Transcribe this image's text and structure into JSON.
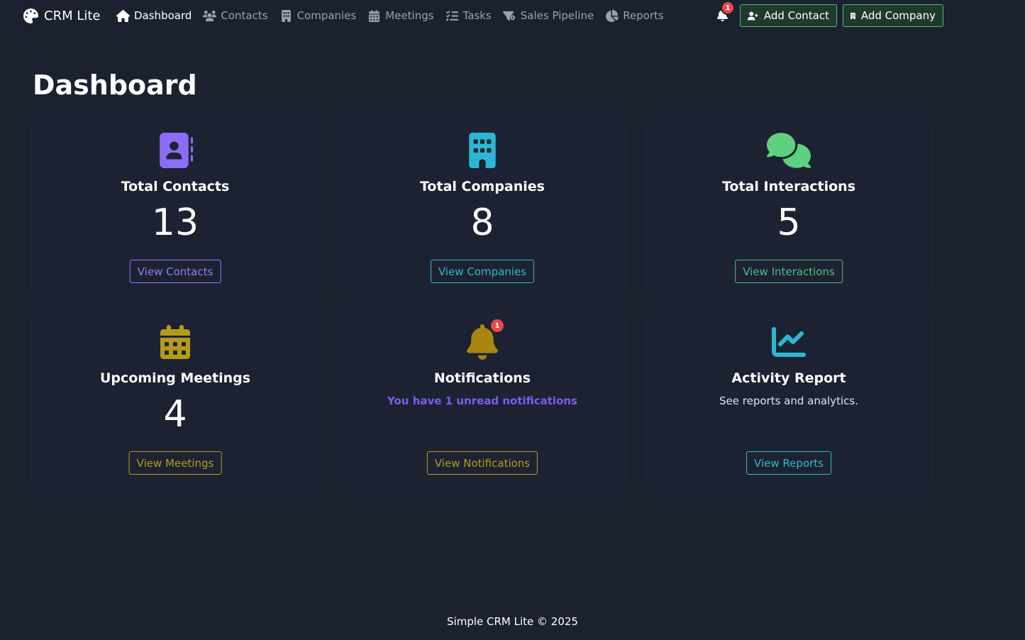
{
  "navbar": {
    "brand": "CRM Lite",
    "brand_icon": "palette-icon",
    "items": [
      {
        "label": "Dashboard",
        "icon": "home-icon",
        "active": true
      },
      {
        "label": "Contacts",
        "icon": "users-icon",
        "active": false
      },
      {
        "label": "Companies",
        "icon": "building-icon",
        "active": false
      },
      {
        "label": "Meetings",
        "icon": "calendar-icon",
        "active": false
      },
      {
        "label": "Tasks",
        "icon": "list-check-icon",
        "active": false
      },
      {
        "label": "Sales Pipeline",
        "icon": "funnel-dollar-icon",
        "active": false
      },
      {
        "label": "Reports",
        "icon": "pie-chart-icon",
        "active": false
      }
    ],
    "notification_count": "1",
    "add_contact": "Add Contact",
    "add_company": "Add Company"
  },
  "page": {
    "title": "Dashboard"
  },
  "cards": {
    "contacts": {
      "title": "Total Contacts",
      "value": "13",
      "button": "View Contacts",
      "icon": "address-book-icon",
      "color": "#8b6cf6"
    },
    "companies": {
      "title": "Total Companies",
      "value": "8",
      "button": "View Companies",
      "icon": "building-icon",
      "color": "#2bb7d4"
    },
    "interactions": {
      "title": "Total Interactions",
      "value": "5",
      "button": "View Interactions",
      "icon": "comments-icon",
      "color": "#5fd07f"
    },
    "meetings": {
      "title": "Upcoming Meetings",
      "value": "4",
      "button": "View Meetings",
      "icon": "calendar-icon",
      "color": "#b59a18"
    },
    "notifications": {
      "title": "Notifications",
      "subtitle": "You have 1 unread notifications",
      "badge": "1",
      "button": "View Notifications",
      "icon": "bell-icon",
      "color": "#a8860f"
    },
    "reports": {
      "title": "Activity Report",
      "subtitle": "See reports and analytics.",
      "button": "View Reports",
      "icon": "chart-line-icon",
      "color": "#2bb7d4"
    }
  },
  "footer": {
    "text": "Simple CRM Lite © 2025"
  }
}
